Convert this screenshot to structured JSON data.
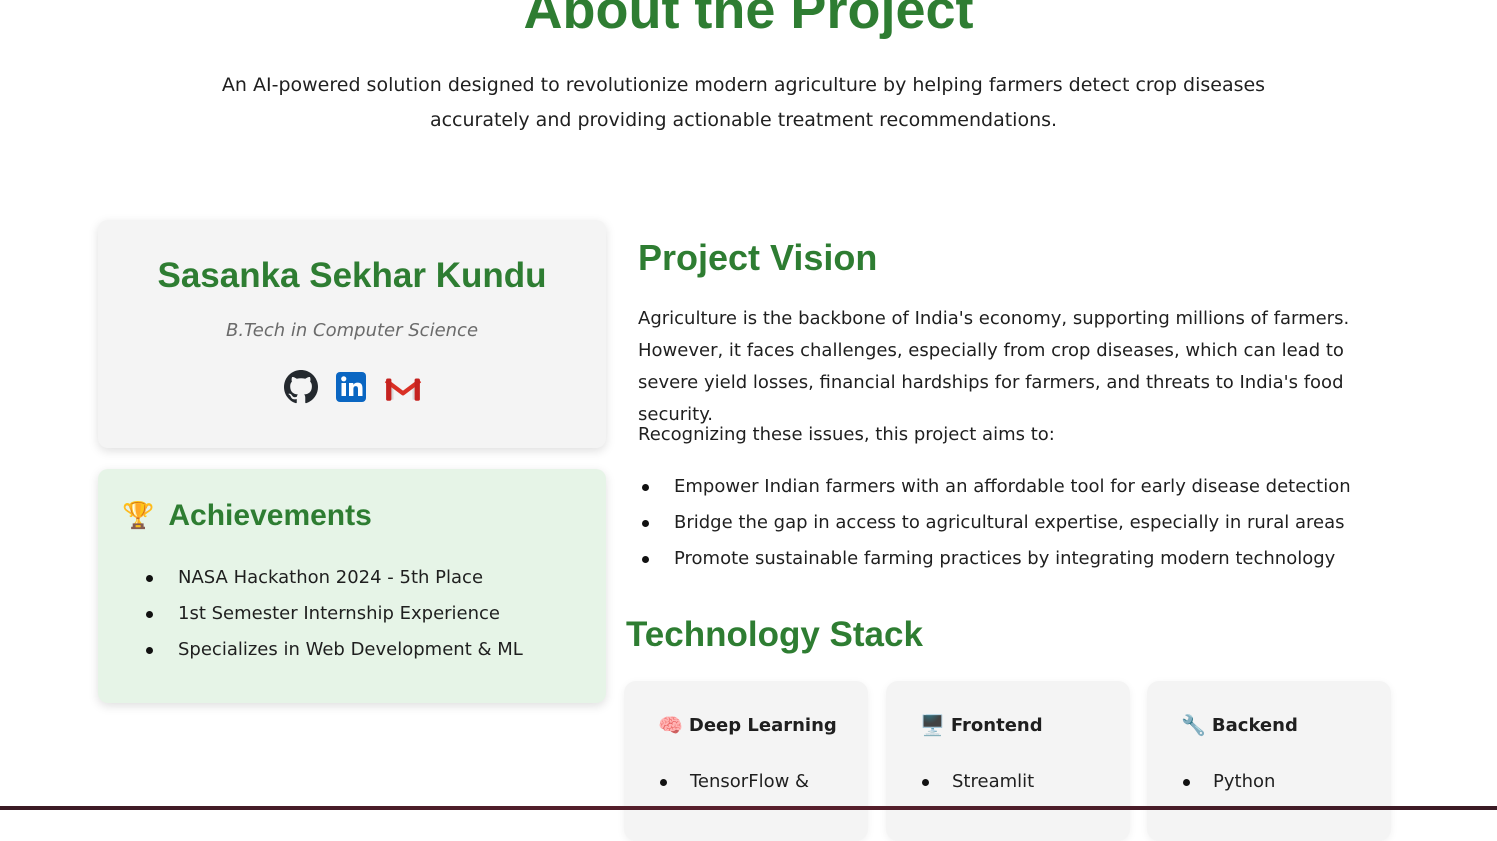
{
  "header": {
    "title": "About the Project",
    "intro": "An AI-powered solution designed to revolutionize modern agriculture by helping farmers detect crop diseases accurately and providing actionable treatment recommendations."
  },
  "profile": {
    "name": "Sasanka Sekhar Kundu",
    "degree": "B.Tech in Computer Science",
    "socials": [
      {
        "icon": "github-icon"
      },
      {
        "icon": "linkedin-icon"
      },
      {
        "icon": "gmail-icon"
      }
    ]
  },
  "achievements": {
    "emoji": "🏆",
    "title": "Achievements",
    "items": [
      "NASA Hackathon 2024 - 5th Place",
      "1st Semester Internship Experience",
      "Specializes in Web Development & ML"
    ]
  },
  "vision": {
    "title": "Project Vision",
    "paragraph": "Agriculture is the backbone of India's economy, supporting millions of farmers. However, it faces challenges, especially from crop diseases, which can lead to severe yield losses, financial hardships for farmers, and threats to India's food security.",
    "aims_intro": "Recognizing these issues, this project aims to:",
    "aims": [
      "Empower Indian farmers with an affordable tool for early disease detection",
      "Bridge the gap in access to agricultural expertise, especially in rural areas",
      "Promote sustainable farming practices by integrating modern technology"
    ]
  },
  "tech": {
    "title": "Technology Stack",
    "cards": [
      {
        "emoji": "🧠",
        "title": "Deep Learning",
        "items": [
          "TensorFlow &"
        ]
      },
      {
        "emoji": "🖥️",
        "title": "Frontend",
        "items": [
          "Streamlit"
        ]
      },
      {
        "emoji": "🔧",
        "title": "Backend",
        "items": [
          "Python"
        ]
      }
    ]
  },
  "colors": {
    "accent_green": "#2e7d32",
    "card_gray": "#f4f4f4",
    "achievements_bg": "#e6f4e7",
    "linkedin_blue": "#0a66c2",
    "gmail_red": "#d93025"
  }
}
